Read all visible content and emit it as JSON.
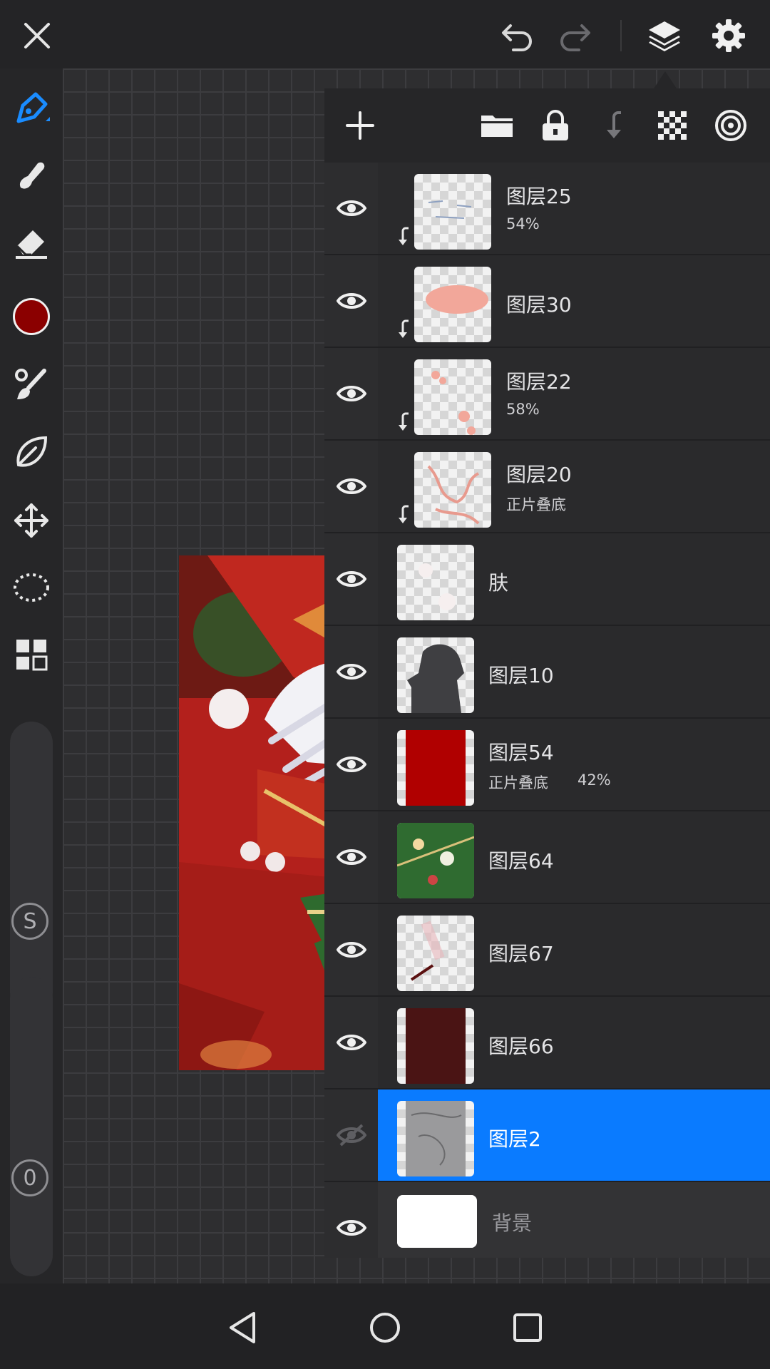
{
  "app": {
    "top_icons": [
      "close-icon",
      "undo-icon",
      "redo-icon",
      "layers-icon",
      "settings-icon"
    ],
    "brush_color": "#8b0000",
    "accent": "#0a7bff"
  },
  "toolbar": {
    "tools": [
      "pen-tool-icon",
      "smudge-tool-icon",
      "eraser-tool-icon",
      "color-swatch",
      "brush-settings-icon",
      "leaf-brush-icon",
      "transform-icon",
      "lasso-icon",
      "layout-icon"
    ],
    "size_label": "S",
    "opacity_label": "0"
  },
  "layers_panel": {
    "header_icons": [
      "add-layer-icon",
      "folder-icon",
      "lock-icon",
      "clip-down-icon",
      "transparency-icon",
      "blend-target-icon"
    ],
    "layers": [
      {
        "name": "图层25",
        "sub": "54%",
        "visible": true,
        "clipped": true
      },
      {
        "name": "图层30",
        "sub": "",
        "visible": true,
        "clipped": true
      },
      {
        "name": "图层22",
        "sub": "58%",
        "visible": true,
        "clipped": true
      },
      {
        "name": "图层20",
        "sub": "正片叠底",
        "visible": true,
        "clipped": true
      },
      {
        "name": "肤",
        "sub": "",
        "visible": true,
        "clipped": false
      },
      {
        "name": "图层10",
        "sub": "",
        "visible": true,
        "clipped": false
      },
      {
        "name": "图层54",
        "sub": "正片叠底",
        "sub2": "42%",
        "visible": true,
        "clipped": false
      },
      {
        "name": "图层64",
        "sub": "",
        "visible": true,
        "clipped": false
      },
      {
        "name": "图层67",
        "sub": "",
        "visible": true,
        "clipped": false
      },
      {
        "name": "图层66",
        "sub": "",
        "visible": true,
        "clipped": false
      },
      {
        "name": "图层2",
        "sub": "",
        "visible": false,
        "clipped": false,
        "selected": true
      },
      {
        "name": "背景",
        "sub": "",
        "visible": true,
        "clipped": false,
        "background": true
      }
    ]
  },
  "navbar": {
    "icons": [
      "back-icon",
      "home-icon",
      "recents-icon"
    ]
  }
}
